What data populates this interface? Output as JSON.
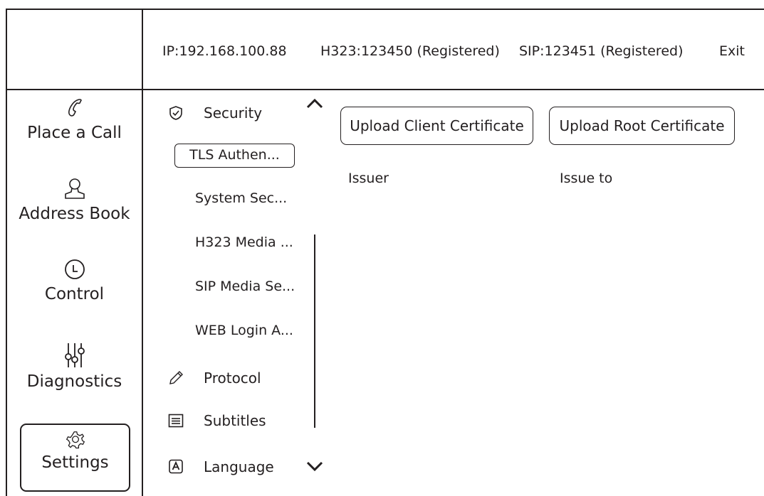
{
  "header": {
    "ip": "IP:192.168.100.88",
    "h323": "H323:123450 (Registered)",
    "sip": "SIP:123451 (Registered)",
    "exit": "Exit"
  },
  "nav": [
    {
      "label": "Place a Call",
      "icon": "phone-icon"
    },
    {
      "label": "Address Book",
      "icon": "person-icon"
    },
    {
      "label": "Control",
      "icon": "clock-icon"
    },
    {
      "label": "Diagnostics",
      "icon": "sliders-icon"
    },
    {
      "label": "Settings",
      "icon": "gear-icon",
      "selected": true
    }
  ],
  "categories": {
    "security": "Security",
    "protocol": "Protocol",
    "subtitles": "Subtitles",
    "language": "Language"
  },
  "security_items": [
    {
      "label": "TLS Authen...",
      "selected": true
    },
    {
      "label": "System Sec..."
    },
    {
      "label": "H323 Media ..."
    },
    {
      "label": "SIP Media Se..."
    },
    {
      "label": "WEB Login A..."
    }
  ],
  "content": {
    "upload_client": "Upload Client  Certificate",
    "upload_root": "Upload Root Certificate",
    "columns": [
      "Issuer",
      "Issue to"
    ]
  }
}
